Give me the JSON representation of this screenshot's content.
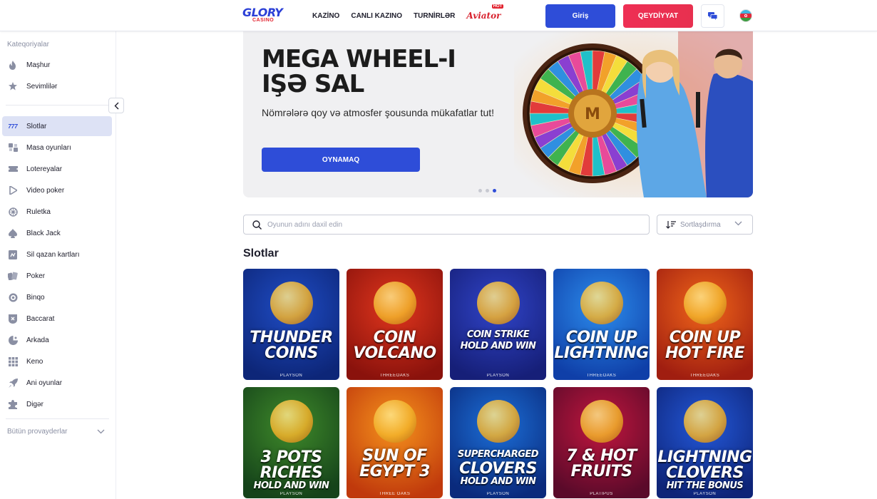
{
  "header": {
    "logo_main": "GLORY",
    "logo_sub": "CASINO",
    "nav": [
      "KAZİNO",
      "CANLI KAZINO",
      "TURNİRLƏR"
    ],
    "aviator": "Aviator",
    "aviator_badge": "HOT",
    "login": "Giriş",
    "register": "QEYDİYYAT",
    "icons": {
      "chat": "chat-icon",
      "flag": "azerbaijan-flag-icon"
    }
  },
  "sidebar": {
    "title": "Kateqoriyalar",
    "top_items": [
      {
        "label": "Maşhur",
        "icon": "fire-icon"
      },
      {
        "label": "Sevimlilər",
        "icon": "star-icon"
      }
    ],
    "items": [
      {
        "label": "Slotlar",
        "icon": "slot-777-icon",
        "active": true
      },
      {
        "label": "Masa oyunları",
        "icon": "table-games-icon"
      },
      {
        "label": "Lotereyalar",
        "icon": "ticket-icon"
      },
      {
        "label": "Video poker",
        "icon": "play-icon"
      },
      {
        "label": "Ruletka",
        "icon": "roulette-icon"
      },
      {
        "label": "Black Jack",
        "icon": "spade-icon"
      },
      {
        "label": "Sil qazan kartları",
        "icon": "scratch-card-icon"
      },
      {
        "label": "Poker",
        "icon": "poker-cards-icon"
      },
      {
        "label": "Binqo",
        "icon": "bingo-icon"
      },
      {
        "label": "Baccarat",
        "icon": "baccarat-icon"
      },
      {
        "label": "Arkada",
        "icon": "arcade-icon"
      },
      {
        "label": "Keno",
        "icon": "keno-grid-icon"
      },
      {
        "label": "Ani oyunlar",
        "icon": "rocket-icon"
      },
      {
        "label": "Digər",
        "icon": "puzzle-icon"
      }
    ],
    "providers": "Bütün provayderlar"
  },
  "banner": {
    "title_line1": "MEGA WHEEL-I",
    "title_line2": "IŞƏ SAL",
    "subtitle": "Nömrələrə qoy və atmosfer şousunda mükafatlar tut!",
    "button": "OYNAMAQ",
    "slides": 3,
    "active_slide": 3
  },
  "search": {
    "placeholder": "Oyunun adını daxil edin"
  },
  "sort": {
    "label": "Sortlaşdırma"
  },
  "section_title": "Slotlar",
  "games": [
    {
      "name_l1": "THUNDER",
      "name_l2": "COINS",
      "provider": "PLAYSON",
      "bg": "#1f4cc4",
      "bg2": "#0d2678"
    },
    {
      "name_l1": "COIN",
      "name_l2": "VOLCANO",
      "provider": "THREEOAKS",
      "bg": "#e0361d",
      "bg2": "#8a120c"
    },
    {
      "name_l1": "COIN STRIKE",
      "name_l2": "HOLD AND WIN",
      "provider": "PLAYSON",
      "bg": "#3044c8",
      "bg2": "#161f78"
    },
    {
      "name_l1": "COIN UP",
      "name_l2": "LIGHTNING",
      "provider": "THREEOAKS",
      "bg": "#2c8cec",
      "bg2": "#0f3fa8"
    },
    {
      "name_l1": "COIN UP",
      "name_l2": "HOT FIRE",
      "provider": "THREEOAKS",
      "bg": "#f0651a",
      "bg2": "#a01e10"
    },
    {
      "name_l1": "3 POTS",
      "name_l2": "RICHES",
      "name_l3": "HOLD AND WIN",
      "provider": "PLAYSON",
      "bg": "#3f8a2a",
      "bg2": "#15431a"
    },
    {
      "name_l1": "SUN OF",
      "name_l2": "EGYPT 3",
      "provider": "THREE OAKS",
      "bg": "#f5921c",
      "bg2": "#c0390c"
    },
    {
      "name_l1": "SUPERCHARGED",
      "name_l2": "CLOVERS",
      "name_l3": "HOLD AND WIN",
      "provider": "PLAYSON",
      "bg": "#1c6fd8",
      "bg2": "#0a2a7c"
    },
    {
      "name_l1": "7 & HOT",
      "name_l2": "FRUITS",
      "provider": "PLATIPUS",
      "bg": "#c1163e",
      "bg2": "#5a0a2a"
    },
    {
      "name_l1": "LIGHTNING",
      "name_l2": "CLOVERS",
      "name_l3": "HIT THE BONUS",
      "provider": "PLAYSON",
      "bg": "#2358d8",
      "bg2": "#0e2478"
    }
  ],
  "colors": {
    "primary": "#2e4dd8",
    "register": "#ee2f54",
    "active_bg": "#dde2f5"
  }
}
